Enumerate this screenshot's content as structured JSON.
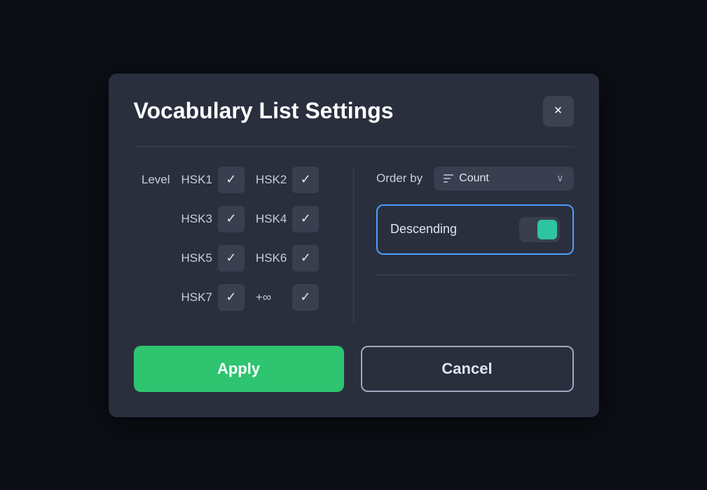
{
  "dialog": {
    "title": "Vocabulary List Settings",
    "close_label": "×"
  },
  "left_panel": {
    "level_label": "Level",
    "rows": [
      {
        "label": "Level",
        "items": [
          {
            "name": "HSK1",
            "checked": true
          },
          {
            "name": "HSK2",
            "checked": true
          }
        ]
      },
      {
        "label": "",
        "items": [
          {
            "name": "HSK3",
            "checked": true
          },
          {
            "name": "HSK4",
            "checked": true
          }
        ]
      },
      {
        "label": "",
        "items": [
          {
            "name": "HSK5",
            "checked": true
          },
          {
            "name": "HSK6",
            "checked": true
          }
        ]
      },
      {
        "label": "",
        "items": [
          {
            "name": "HSK7",
            "checked": true
          },
          {
            "name": "+∞",
            "checked": true
          }
        ]
      }
    ]
  },
  "right_panel": {
    "order_label": "Order by",
    "order_value": "Count",
    "descending_label": "Descending",
    "toggle_on": true
  },
  "footer": {
    "apply_label": "Apply",
    "cancel_label": "Cancel"
  }
}
